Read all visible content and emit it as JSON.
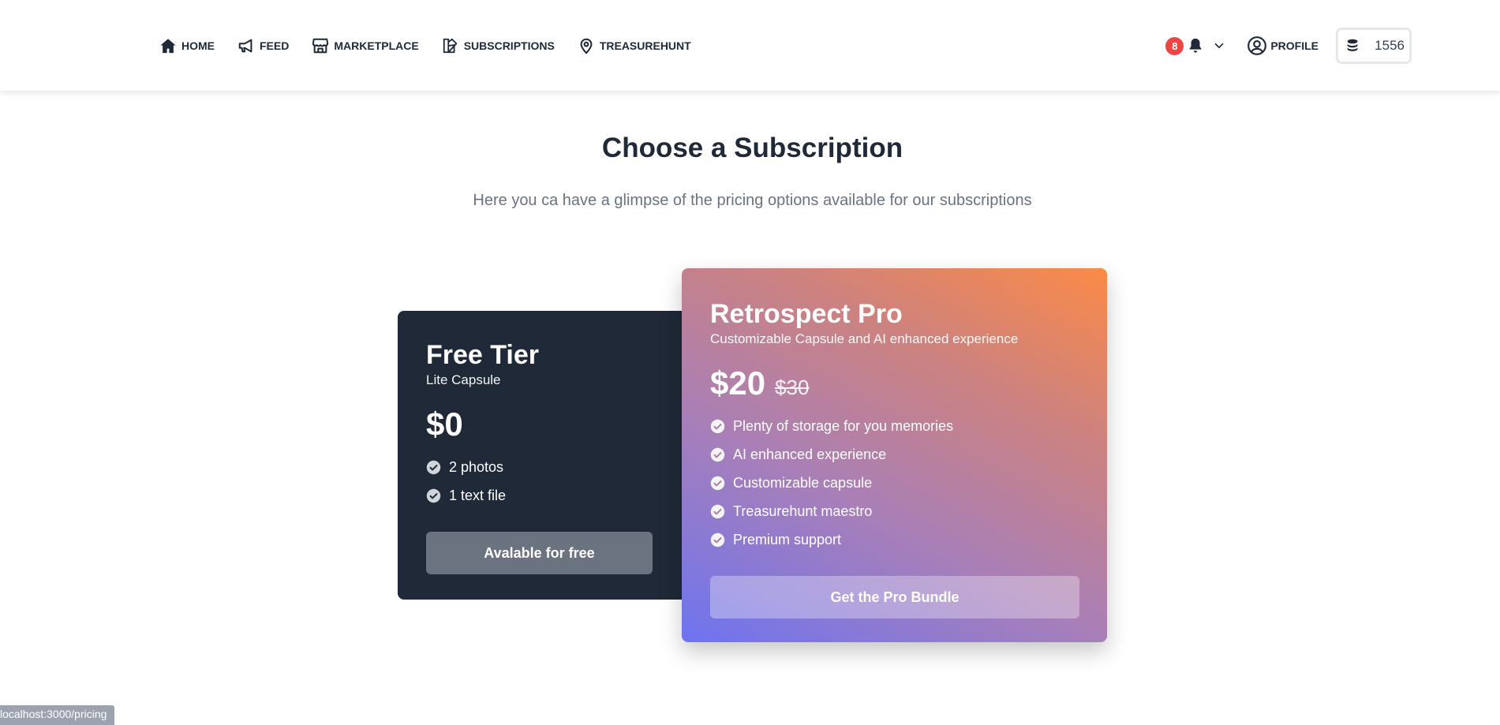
{
  "nav": {
    "left_items": [
      {
        "label": "HOME",
        "icon": "home-icon"
      },
      {
        "label": "FEED",
        "icon": "megaphone-icon"
      },
      {
        "label": "MARKETPLACE",
        "icon": "store-icon"
      },
      {
        "label": "SUBSCRIPTIONS",
        "icon": "swatch-icon"
      },
      {
        "label": "TREASUREHUNT",
        "icon": "map-pin-icon"
      }
    ],
    "notifications_count": "8",
    "profile_label": "PROFILE",
    "coins": "1556"
  },
  "header": {
    "title": "Choose a Subscription",
    "subtitle": "Here you ca have a glimpse of the pricing options available for our subscriptions"
  },
  "plans": {
    "free": {
      "name": "Free Tier",
      "description": "Lite Capsule",
      "price": "$0",
      "features": [
        "2 photos",
        "1 text file"
      ],
      "button_label": "Avalable for free"
    },
    "pro": {
      "name": "Retrospect Pro",
      "description": "Customizable Capsule and AI enhanced experience",
      "price": "$20",
      "old_price": "$30",
      "features": [
        "Plenty of storage for you memories",
        "AI enhanced experience",
        "Customizable capsule",
        "Treasurehunt maestro",
        "Premium support"
      ],
      "button_label": "Get the Pro Bundle"
    }
  },
  "status_bar": "localhost:3000/pricing",
  "colors": {
    "dark_card": "#1f2937",
    "badge_red": "#ef4444",
    "gradient_start": "#6d74f0",
    "gradient_end": "#fc8a47"
  }
}
